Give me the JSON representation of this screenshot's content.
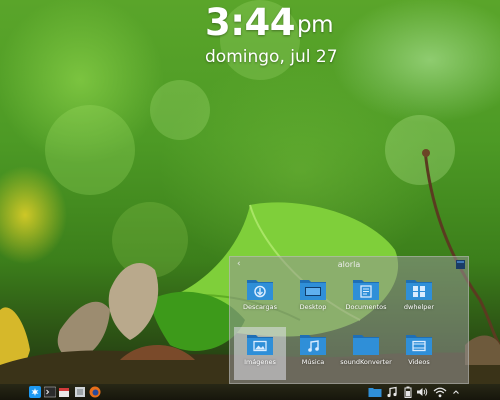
{
  "desktop": {
    "wallpaper": "green-leaf-macro"
  },
  "clock": {
    "time": "3:44",
    "ampm": "pm",
    "date": "domingo, jul 27"
  },
  "folder_view": {
    "title": "alorla",
    "back_icon": "chevron-left-icon",
    "items": [
      {
        "label": "Descargas",
        "icon": "download-folder-icon"
      },
      {
        "label": "Desktop",
        "icon": "desktop-folder-icon"
      },
      {
        "label": "Documentos",
        "icon": "documents-folder-icon"
      },
      {
        "label": "dwhelper",
        "icon": "apps-folder-icon"
      },
      {
        "label": "Imágenes",
        "icon": "pictures-folder-icon",
        "selected": true
      },
      {
        "label": "Música",
        "icon": "music-folder-icon"
      },
      {
        "label": "soundKonverter",
        "icon": "folder-icon"
      },
      {
        "label": "Videos",
        "icon": "videos-folder-icon"
      }
    ]
  },
  "taskbar": {
    "launcher_icon": "kde-launcher-icon",
    "tasks": [
      "terminal-icon",
      "calendar-icon",
      "system-settings-icon",
      "firefox-icon"
    ],
    "tray": [
      "folder-icon",
      "music-note-icon",
      "battery-icon",
      "volume-icon",
      "wifi-icon",
      "expand-tray-icon"
    ]
  },
  "colors": {
    "folder_blue": "#2f8fd8",
    "folder_tab": "#1f6fb5",
    "panel_bg": "rgba(150,150,150,0.55)"
  }
}
